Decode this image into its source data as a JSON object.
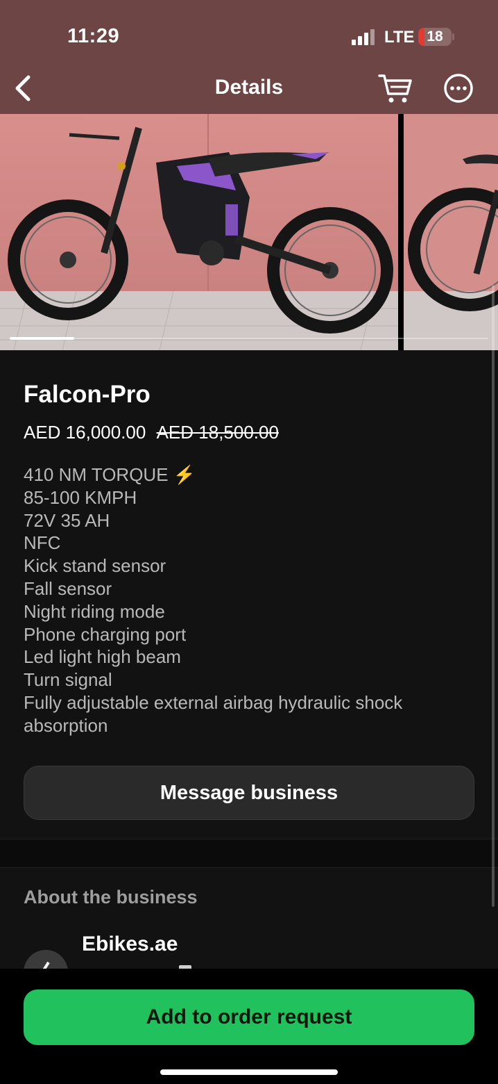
{
  "status_bar": {
    "time": "11:29",
    "network": "LTE",
    "battery": "18",
    "battery_level_percent": 18
  },
  "nav": {
    "title": "Details",
    "back_icon": "chevron-left-icon",
    "cart_icon": "shopping-cart-icon",
    "more_icon": "more-options-icon"
  },
  "gallery": {
    "current_index": 1
  },
  "product": {
    "title": "Falcon-Pro",
    "price": "AED 16,000.00",
    "original_price": "AED 18,500.00",
    "features": [
      "410 NM TORQUE ⚡",
      "85-100 KMPH",
      "72V 35 AH",
      "NFC",
      "Kick stand sensor",
      "Fall sensor",
      "Night riding mode",
      "Phone charging port",
      "Led light high beam",
      "Turn signal",
      "Fully adjustable external airbag hydraulic shock absorption"
    ]
  },
  "actions": {
    "message_label": "Message business",
    "order_label": "Add to order request"
  },
  "about": {
    "title": "About the business",
    "business_name": "Ebikes.ae"
  },
  "colors": {
    "header_bg": "#6d4544",
    "accent_green": "#21c25e",
    "battery_red": "#e63a30"
  }
}
